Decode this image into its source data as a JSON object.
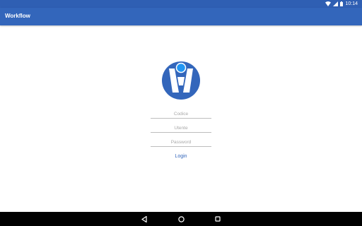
{
  "status_bar": {
    "time": "10:14",
    "icons": [
      "wifi-icon",
      "signal-icon",
      "battery-icon"
    ]
  },
  "app_bar": {
    "title": "Workflow",
    "color": "#3366bb"
  },
  "logo": {
    "icon": "workflow-logo-icon",
    "colors": {
      "primary": "#3366bb",
      "accent": "#2196f3"
    }
  },
  "form": {
    "codice_placeholder": "Codice",
    "utente_placeholder": "Utente",
    "password_placeholder": "Password",
    "login_label": "Login"
  },
  "nav_bar": {
    "icons": [
      "back-icon",
      "home-icon",
      "recents-icon"
    ]
  }
}
